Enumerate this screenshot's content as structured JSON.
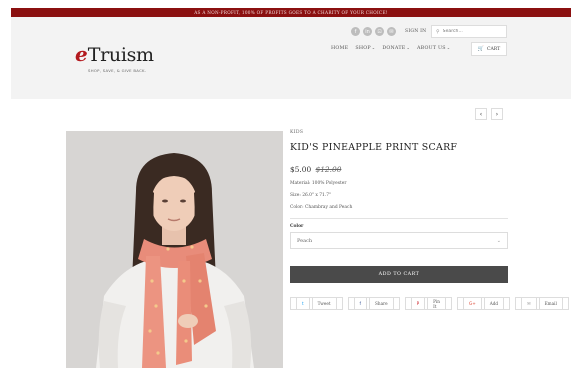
{
  "banner": {
    "text": "AS A NON-PROFIT, 100% OF PROFITS GOES TO A CHARITY OF YOUR CHOICE!"
  },
  "logo": {
    "prefix": "e",
    "name": "Truism",
    "tagline": "SHOP, SAVE, & GIVE BACK."
  },
  "header": {
    "social_icons": [
      "f",
      "in",
      "⊡",
      "✉"
    ],
    "signin_label": "SIGN IN",
    "search_glyph": "⚲",
    "search_placeholder": "Search...",
    "nav": [
      {
        "label": "HOME",
        "caret": ""
      },
      {
        "label": "SHOP",
        "caret": "⌄"
      },
      {
        "label": "DONATE",
        "caret": "⌄"
      },
      {
        "label": "ABOUT US",
        "caret": "⌄"
      }
    ],
    "cart_icon": "🛒",
    "cart_label": "CART"
  },
  "pager": {
    "prev": "‹",
    "next": "›"
  },
  "product": {
    "category": "KIDS",
    "title": "KID'S PINEAPPLE PRINT SCARF",
    "price": "$5.00",
    "price_old": "$12.00",
    "material": "Material: 100% Polyester",
    "size": "Size: 26.0\" x 71.7\"",
    "color_spec": "Color: Chambray and Peach",
    "color_label": "Color",
    "color_selected": "Peach",
    "chevron": "⌄",
    "add_to_cart": "ADD TO CART"
  },
  "share": [
    {
      "icon": "t",
      "label": "Tweet",
      "color": "#1da1f2"
    },
    {
      "icon": "f",
      "label": "Share",
      "color": "#3b5998"
    },
    {
      "icon": "P",
      "label": "Pin It",
      "color": "#cb2027"
    },
    {
      "icon": "G+",
      "label": "Add",
      "color": "#dd4b39"
    },
    {
      "icon": "✉",
      "label": "Email",
      "color": "#999999"
    }
  ]
}
